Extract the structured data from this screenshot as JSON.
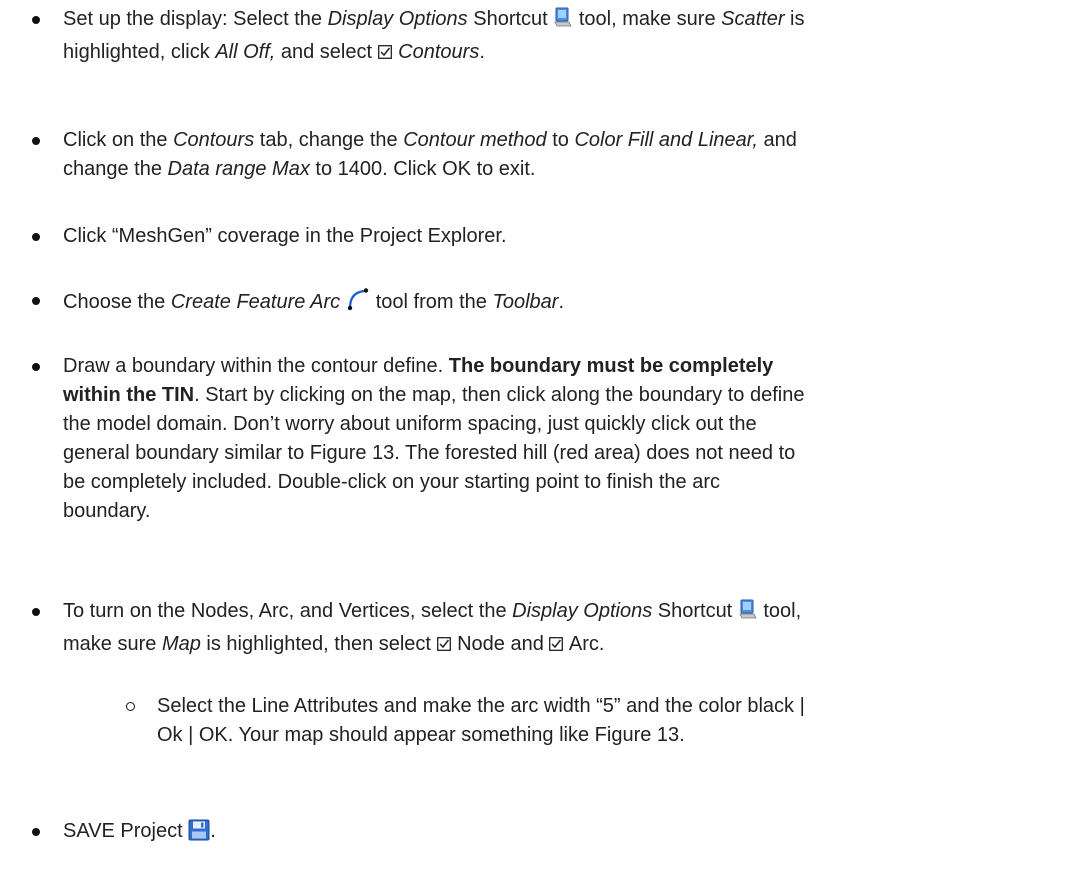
{
  "bullets": {
    "b1": {
      "l1a": "Set up the display: Select the ",
      "l1b": "Display Options",
      "l1c": " Shortcut ",
      "l1d": " tool, make sure ",
      "l1e": "Scatter",
      "l1f": " is",
      "l2a": "highlighted, click ",
      "l2b": "All Off,",
      "l2c": " and select ",
      "l2d": " Contours",
      "l2e": ".",
      "icon": "display-options-icon"
    },
    "b2": {
      "l1a": "Click on the ",
      "l1b": "Contours",
      "l1c": " tab, change the ",
      "l1d": "Contour method",
      "l1e": " to ",
      "l1f": "Color Fill and Linear,",
      "l1g": " and",
      "l2a": "change the ",
      "l2b": "Data range Max",
      "l2c": " to 1400. Click OK to exit."
    },
    "b3": {
      "l1": "Click “MeshGen” coverage in the Project Explorer."
    },
    "b4": {
      "l1a": "Choose the ",
      "l1b": "Create Feature Arc",
      "l1c": " tool from the ",
      "l1d": "Toolbar",
      "l1e": ".",
      "icon": "create-feature-arc-icon"
    },
    "b5": {
      "l1a": "Draw a boundary within the contour define. ",
      "l1b": "The boundary must be completely",
      "l2a": "within the TIN",
      "l2b": ". Start by clicking on the map, then click along the boundary to define",
      "l3": "the model domain. Don’t worry about uniform spacing, just quickly click out the",
      "l4": "general boundary similar to Figure 13. The forested hill (red area) does not need to",
      "l5": "be completely included. Double-click on your starting point to finish the arc",
      "l6": "boundary."
    },
    "b6": {
      "l1a": "To turn on the Nodes, Arc, and Vertices, select the ",
      "l1b": "Display Options",
      "l1c": " Shortcut ",
      "l1d": " tool,",
      "l2a": "make sure ",
      "l2b": "Map",
      "l2c": " is highlighted, then select ",
      "l2d": " Node and ",
      "l2e": " Arc.",
      "icon": "display-options-icon"
    },
    "b6sub": {
      "l1": "Select the Line Attributes and make the arc width “5” and the color black |",
      "l2": "Ok | OK. Your map should appear something like Figure 13."
    },
    "b7": {
      "l1a": "SAVE Project ",
      "l1b": ".",
      "icon": "save-icon"
    }
  }
}
